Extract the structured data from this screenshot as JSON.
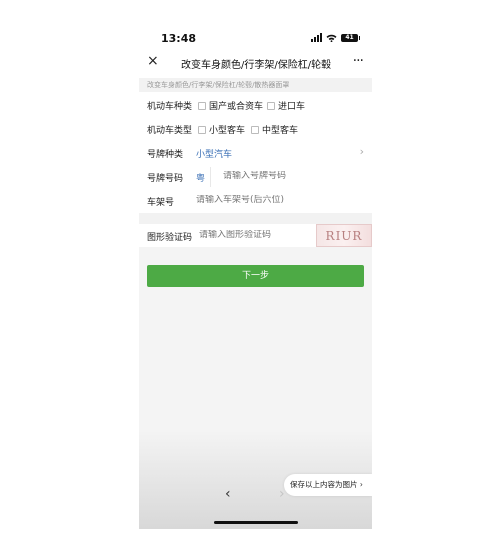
{
  "status_bar": {
    "time": "13:48",
    "battery": "41"
  },
  "nav": {
    "close_icon": "×",
    "title": "改变车身颜色/行李架/保险杠/轮毂",
    "more_icon": "···"
  },
  "breadcrumb": "改变车身颜色/行李架/保险杠/轮毂/散热器面罩",
  "form": {
    "vehicle_category": {
      "label": "机动车种类",
      "options": [
        "国产或合资车",
        "进口车"
      ]
    },
    "vehicle_type": {
      "label": "机动车类型",
      "options": [
        "小型客车",
        "中型客车"
      ]
    },
    "plate_type": {
      "label": "号牌种类",
      "value": "小型汽车",
      "chevron": "›"
    },
    "plate_number": {
      "label": "号牌号码",
      "prefix": "粤",
      "placeholder": "请输入号牌号码"
    },
    "vin": {
      "label": "车架号",
      "placeholder": "请输入车架号(后六位)"
    },
    "captcha": {
      "label": "图形验证码",
      "placeholder": "请输入图形验证码",
      "image_text": "RIUR"
    }
  },
  "next_button": "下一步",
  "save_bubble": "保存以上内容为图片 ›",
  "bottom_nav": {
    "back": "‹",
    "forward": "›"
  },
  "colors": {
    "primary_green": "#4daa45",
    "link_blue": "#3a6fb5"
  }
}
